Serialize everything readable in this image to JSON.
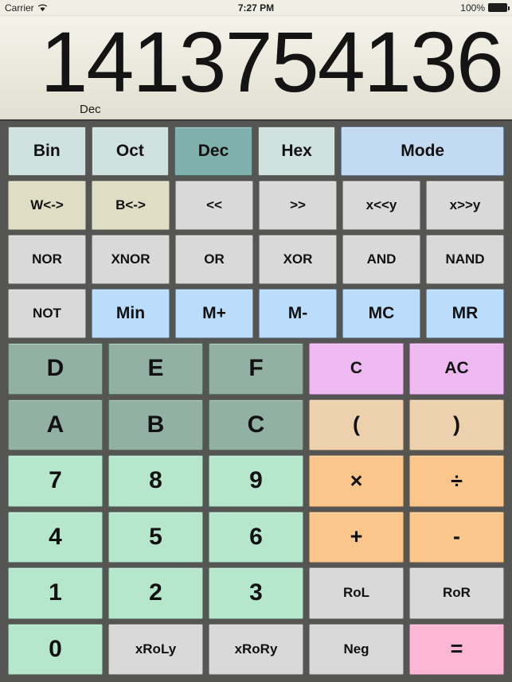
{
  "statusbar": {
    "carrier": "Carrier",
    "wifi_icon": "wifi-icon",
    "time": "7:27 PM",
    "battery_percent": "100%",
    "battery_icon": "battery-full-icon"
  },
  "display": {
    "value": "1413754136",
    "base_label": "Dec"
  },
  "keypad": {
    "rows": [
      {
        "name": "base-and-mode-row",
        "keys": [
          {
            "label": "Bin",
            "name": "base-bin-button",
            "style": "c-base",
            "size": "fs-md"
          },
          {
            "label": "Oct",
            "name": "base-oct-button",
            "style": "c-base",
            "size": "fs-md"
          },
          {
            "label": "Dec",
            "name": "base-dec-button",
            "style": "c-base-sel",
            "size": "fs-md"
          },
          {
            "label": "Hex",
            "name": "base-hex-button",
            "style": "c-base",
            "size": "fs-md"
          },
          {
            "label": "Mode",
            "name": "mode-button",
            "style": "c-mode",
            "size": "fs-md",
            "wide": true
          }
        ]
      },
      {
        "name": "shift-row",
        "keys": [
          {
            "label": "W<->",
            "name": "word-swap-button",
            "style": "c-khaki",
            "size": "fs-sm"
          },
          {
            "label": "B<->",
            "name": "byte-swap-button",
            "style": "c-khaki",
            "size": "fs-sm"
          },
          {
            "label": "<<",
            "name": "shift-left-button",
            "style": "c-gray",
            "size": "fs-sm"
          },
          {
            "label": ">>",
            "name": "shift-right-button",
            "style": "c-gray",
            "size": "fs-sm"
          },
          {
            "label": "x<<y",
            "name": "shift-left-y-button",
            "style": "c-gray",
            "size": "fs-sm"
          },
          {
            "label": "x>>y",
            "name": "shift-right-y-button",
            "style": "c-gray",
            "size": "fs-sm"
          }
        ]
      },
      {
        "name": "logic-row",
        "keys": [
          {
            "label": "NOR",
            "name": "nor-button",
            "style": "c-gray",
            "size": "fs-sm"
          },
          {
            "label": "XNOR",
            "name": "xnor-button",
            "style": "c-gray",
            "size": "fs-sm"
          },
          {
            "label": "OR",
            "name": "or-button",
            "style": "c-gray",
            "size": "fs-sm"
          },
          {
            "label": "XOR",
            "name": "xor-button",
            "style": "c-gray",
            "size": "fs-sm"
          },
          {
            "label": "AND",
            "name": "and-button",
            "style": "c-gray",
            "size": "fs-sm"
          },
          {
            "label": "NAND",
            "name": "nand-button",
            "style": "c-gray",
            "size": "fs-sm"
          }
        ]
      },
      {
        "name": "memory-row",
        "keys": [
          {
            "label": "NOT",
            "name": "not-button",
            "style": "c-gray",
            "size": "fs-sm"
          },
          {
            "label": "Min",
            "name": "memory-in-button",
            "style": "c-blue",
            "size": "fs-md"
          },
          {
            "label": "M+",
            "name": "memory-add-button",
            "style": "c-blue",
            "size": "fs-md"
          },
          {
            "label": "M-",
            "name": "memory-sub-button",
            "style": "c-blue",
            "size": "fs-md"
          },
          {
            "label": "MC",
            "name": "memory-clear-button",
            "style": "c-blue",
            "size": "fs-md"
          },
          {
            "label": "MR",
            "name": "memory-recall-button",
            "style": "c-blue",
            "size": "fs-md"
          }
        ]
      },
      {
        "name": "hex-def-clear-row",
        "keys": [
          {
            "label": "D",
            "name": "digit-d-button",
            "style": "c-sage",
            "size": "fs-xl"
          },
          {
            "label": "E",
            "name": "digit-e-button",
            "style": "c-sage",
            "size": "fs-xl"
          },
          {
            "label": "F",
            "name": "digit-f-button",
            "style": "c-sage",
            "size": "fs-xl"
          },
          {
            "label": "C",
            "name": "clear-button",
            "style": "c-violet",
            "size": "fs-md"
          },
          {
            "label": "AC",
            "name": "all-clear-button",
            "style": "c-violet",
            "size": "fs-md"
          }
        ]
      },
      {
        "name": "hex-abc-paren-row",
        "keys": [
          {
            "label": "A",
            "name": "digit-a-button",
            "style": "c-sage",
            "size": "fs-xl"
          },
          {
            "label": "B",
            "name": "digit-b-button",
            "style": "c-sage",
            "size": "fs-xl"
          },
          {
            "label": "C",
            "name": "digit-c-button",
            "style": "c-sage",
            "size": "fs-xl"
          },
          {
            "label": "(",
            "name": "left-paren-button",
            "style": "c-tan",
            "size": "fs-lg"
          },
          {
            "label": ")",
            "name": "right-paren-button",
            "style": "c-tan",
            "size": "fs-lg"
          }
        ]
      },
      {
        "name": "digits-789-row",
        "keys": [
          {
            "label": "7",
            "name": "digit-7-button",
            "style": "c-mint",
            "size": "fs-xl"
          },
          {
            "label": "8",
            "name": "digit-8-button",
            "style": "c-mint",
            "size": "fs-xl"
          },
          {
            "label": "9",
            "name": "digit-9-button",
            "style": "c-mint",
            "size": "fs-xl"
          },
          {
            "label": "×",
            "name": "multiply-button",
            "style": "c-orange",
            "size": "fs-lg"
          },
          {
            "label": "÷",
            "name": "divide-button",
            "style": "c-orange",
            "size": "fs-lg"
          }
        ]
      },
      {
        "name": "digits-456-row",
        "keys": [
          {
            "label": "4",
            "name": "digit-4-button",
            "style": "c-mint",
            "size": "fs-xl"
          },
          {
            "label": "5",
            "name": "digit-5-button",
            "style": "c-mint",
            "size": "fs-xl"
          },
          {
            "label": "6",
            "name": "digit-6-button",
            "style": "c-mint",
            "size": "fs-xl"
          },
          {
            "label": "+",
            "name": "plus-button",
            "style": "c-orange",
            "size": "fs-lg"
          },
          {
            "label": "-",
            "name": "minus-button",
            "style": "c-orange",
            "size": "fs-lg"
          }
        ]
      },
      {
        "name": "digits-123-row",
        "keys": [
          {
            "label": "1",
            "name": "digit-1-button",
            "style": "c-mint",
            "size": "fs-xl"
          },
          {
            "label": "2",
            "name": "digit-2-button",
            "style": "c-mint",
            "size": "fs-xl"
          },
          {
            "label": "3",
            "name": "digit-3-button",
            "style": "c-mint",
            "size": "fs-xl"
          },
          {
            "label": "RoL",
            "name": "rotate-left-button",
            "style": "c-gray",
            "size": "fs-sm"
          },
          {
            "label": "RoR",
            "name": "rotate-right-button",
            "style": "c-gray",
            "size": "fs-sm"
          }
        ]
      },
      {
        "name": "zero-and-equals-row",
        "keys": [
          {
            "label": "0",
            "name": "digit-0-button",
            "style": "c-mint",
            "size": "fs-xl"
          },
          {
            "label": "xRoLy",
            "name": "rotate-left-y-button",
            "style": "c-gray",
            "size": "fs-sm"
          },
          {
            "label": "xRoRy",
            "name": "rotate-right-y-button",
            "style": "c-gray",
            "size": "fs-sm"
          },
          {
            "label": "Neg",
            "name": "negate-button",
            "style": "c-gray",
            "size": "fs-sm"
          },
          {
            "label": "=",
            "name": "equals-button",
            "style": "c-pink",
            "size": "fs-lg"
          }
        ]
      }
    ]
  }
}
